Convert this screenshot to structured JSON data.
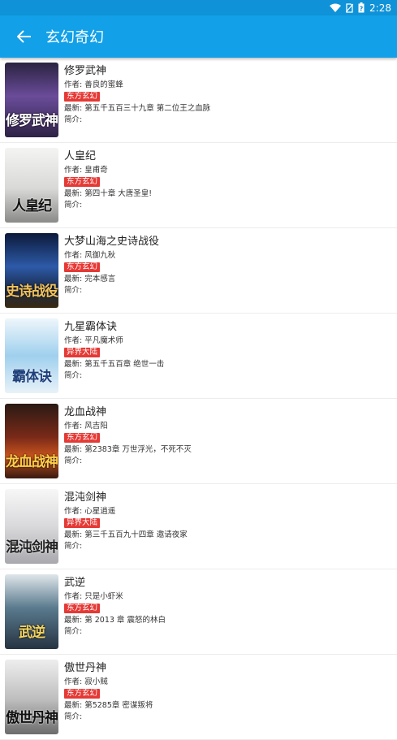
{
  "status_bar": {
    "time": "2:28"
  },
  "app_bar": {
    "title": "玄幻奇幻"
  },
  "colors": {
    "app_bar": "#12a0e8",
    "status_bar": "#0f92d8",
    "tag": "#e53935"
  },
  "books": [
    {
      "name": "修罗武神",
      "author": "作者: 善良的蜜蜂",
      "tag": "东方玄幻",
      "latest": "最新: 第五千五百三十九章 第二位王之血脉",
      "intro": "简介:",
      "cover_text": "修罗武神"
    },
    {
      "name": "人皇纪",
      "author": "作者: 皇甫奇",
      "tag": "东方玄幻",
      "latest": "最新: 第四十章 大唐圣皇!",
      "intro": "简介:",
      "cover_text": "人皇纪"
    },
    {
      "name": "大梦山海之史诗战役",
      "author": "作者: 风御九秋",
      "tag": "东方玄幻",
      "latest": "最新: 完本感言",
      "intro": "简介:",
      "cover_text": "史诗战役"
    },
    {
      "name": "九星霸体诀",
      "author": "作者: 平凡魔术师",
      "tag": "异界大陆",
      "latest": "最新: 第五千五百章 绝世一击",
      "intro": "简介:",
      "cover_text": "霸体诀"
    },
    {
      "name": "龙血战神",
      "author": "作者: 风吉阳",
      "tag": "东方玄幻",
      "latest": "最新: 第2383章 万世浮光，不死不灭",
      "intro": "简介:",
      "cover_text": "龙血战神"
    },
    {
      "name": "混沌剑神",
      "author": "作者: 心星逍遥",
      "tag": "异界大陆",
      "latest": "最新: 第三千五百九十四章 邀请夜家",
      "intro": "简介:",
      "cover_text": "混沌剑神"
    },
    {
      "name": "武逆",
      "author": "作者: 只是小虾米",
      "tag": "东方玄幻",
      "latest": "最新: 第 2013 章 震怒的林白",
      "intro": "简介:",
      "cover_text": "武逆"
    },
    {
      "name": "傲世丹神",
      "author": "作者: 寂小贼",
      "tag": "东方玄幻",
      "latest": "最新: 第5285章 密谋叛将",
      "intro": "简介:",
      "cover_text": "傲世丹神"
    }
  ]
}
